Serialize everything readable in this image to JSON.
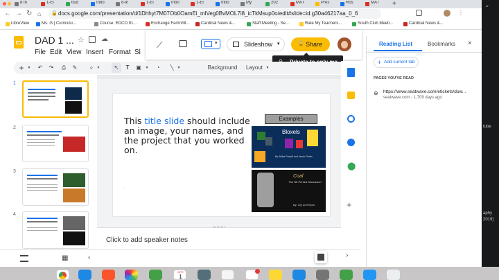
{
  "tabs": [
    "8 In",
    "1-Ei",
    "bud",
    "Inbo",
    "8-In",
    "1-El",
    "Inbo",
    "1-El",
    "Inbo",
    "My",
    "202",
    "MAT",
    "Pres",
    "Ros",
    "MAT"
  ],
  "url": "docs.google.com/presentation/d/1Dhhyt7M07Ob0OamEi_mlVeg0BvMOL7i8_icTkMsup0o/edit#slide=id.g30a46217aa_0_6",
  "bookmarks": [
    "LibreView",
    "Ms. G | Curriculu...",
    "Course: EDCO 91...",
    "Exchange FarmVill...",
    "Cardinal News &...",
    "Staff Meeting - Se...",
    "Rate My Teachers...",
    "South Club Meeti...",
    "Cardinal News &..."
  ],
  "doc": {
    "title": "DAD 1 ...",
    "menus": [
      "File",
      "Edit",
      "View",
      "Insert",
      "Format",
      "Sl"
    ]
  },
  "header_buttons": {
    "slideshow": "Slideshow",
    "share": "Share",
    "tooltip": "Private to only me"
  },
  "toolbar": {
    "background": "Background",
    "layout": "Layout"
  },
  "thumbs": [
    "1",
    "2",
    "3",
    "4"
  ],
  "slide": {
    "pre": "This ",
    "highlight": "title slide",
    "post": " should include an image, your names, and the project that you worked on.",
    "examples_label": "Examples",
    "bloxels_label": "Bloxels",
    "bloxels_byline": "By: Miles Pastoff and Jacob Fisher",
    "coal_title": "Coal",
    "coal_sub": "The 3D Printed Discussion",
    "coal_byline": "By: Lily and Ryan"
  },
  "notes_placeholder": "Click to add speaker notes",
  "side_panel": {
    "tab_reading": "Reading List",
    "tab_bookmarks": "Bookmarks",
    "add_current": "Add current tab",
    "section": "PAGES YOU'VE READ",
    "item_url": "https://www.seatwave.com/etickets/dow...",
    "item_meta": "seatwave.com - 1,709 days ago"
  },
  "dock_date": {
    "month": "APR",
    "day": "1"
  },
  "colors": {
    "share": "#fbbc04",
    "accent": "#1a73e8"
  }
}
